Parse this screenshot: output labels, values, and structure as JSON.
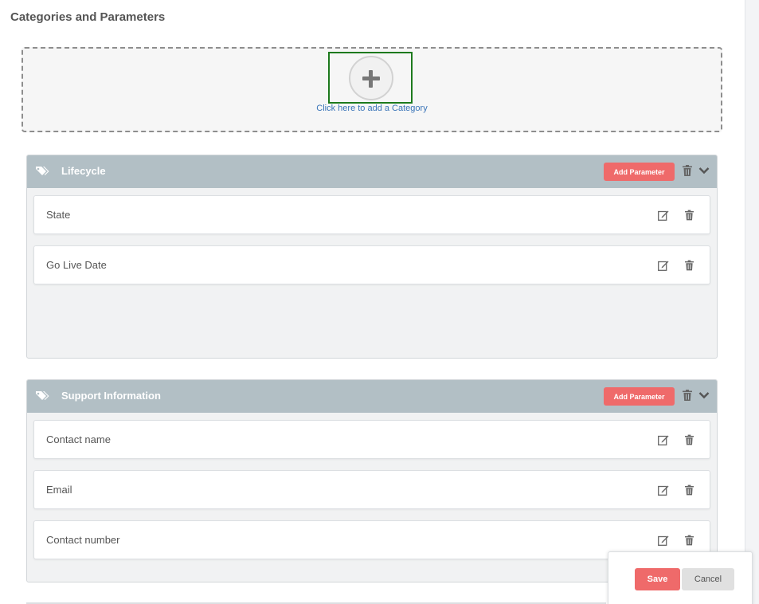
{
  "page": {
    "title": "Categories and Parameters"
  },
  "add_category": {
    "link_text": "Click here to add a Category"
  },
  "categories": [
    {
      "name": "Lifecycle",
      "add_parameter_label": "Add Parameter",
      "parameters": [
        {
          "label": "State"
        },
        {
          "label": "Go Live Date"
        }
      ]
    },
    {
      "name": "Support Information",
      "add_parameter_label": "Add Parameter",
      "parameters": [
        {
          "label": "Contact name"
        },
        {
          "label": "Email"
        },
        {
          "label": "Contact number"
        }
      ]
    }
  ],
  "footer": {
    "save_label": "Save",
    "cancel_label": "Cancel"
  },
  "colors": {
    "accent": "#ef6a6a",
    "header": "#b2bfc5",
    "link": "#3a74b8",
    "focus": "#1e7a1e"
  }
}
